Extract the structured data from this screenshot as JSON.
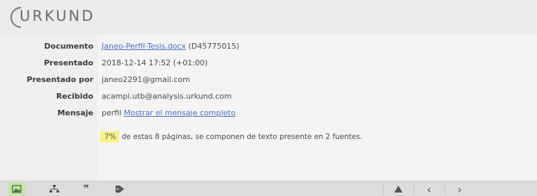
{
  "header": {
    "logo_text": "URKUND"
  },
  "details": {
    "documento": {
      "label": "Documento",
      "file_link": "Janeo-Perfil-Tesis.docx",
      "file_id": "(D45775015)"
    },
    "presentado": {
      "label": "Presentado",
      "value": "2018-12-14 17:52 (+01:00)"
    },
    "presentado_por": {
      "label": "Presentado por",
      "value": "janeo2291@gmail.com"
    },
    "recibido": {
      "label": "Recibido",
      "value": "acampi.utb@analysis.urkund.com"
    },
    "mensaje": {
      "label": "Mensaje",
      "value": "perfil",
      "link": "Mostrar el mensaje completo"
    }
  },
  "summary": {
    "percent": "7%",
    "text": "de estas 8 páginas, se componen de texto presente en 2 fuentes."
  },
  "toolbar": {
    "buttons": [
      "image-icon",
      "sitemap-icon",
      "quote-icon",
      "tag-icon",
      "warning-icon",
      "chevron-left-icon",
      "chevron-right-icon"
    ]
  }
}
